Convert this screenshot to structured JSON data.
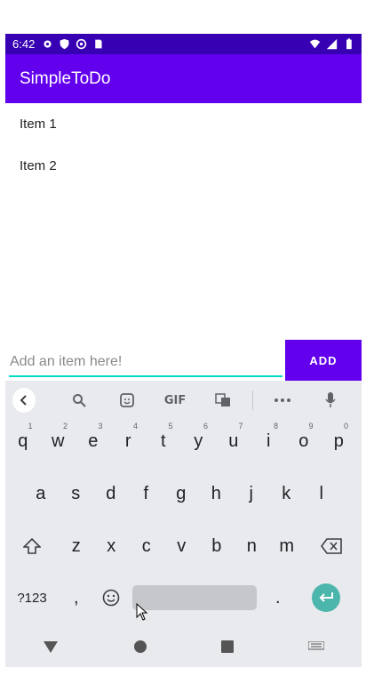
{
  "status_bar": {
    "time": "6:42",
    "icons_left": [
      "gear-icon",
      "shield-icon",
      "at-icon",
      "sd-card-icon"
    ],
    "icons_right": [
      "wifi-icon",
      "signal-icon",
      "battery-icon"
    ]
  },
  "app_bar": {
    "title": "SimpleToDo",
    "color": "#6200ee"
  },
  "list": {
    "items": [
      "Item 1",
      "Item 2"
    ]
  },
  "input": {
    "placeholder": "Add an item here!",
    "value": ""
  },
  "add_button": {
    "label": "ADD"
  },
  "keyboard": {
    "toolbar": {
      "gif_label": "GIF",
      "icons": [
        "chevron-left-icon",
        "search-icon",
        "sticker-icon",
        "gif-icon",
        "translate-icon",
        "more-icon",
        "mic-icon"
      ]
    },
    "row1": [
      {
        "k": "q",
        "h": "1"
      },
      {
        "k": "w",
        "h": "2"
      },
      {
        "k": "e",
        "h": "3"
      },
      {
        "k": "r",
        "h": "4"
      },
      {
        "k": "t",
        "h": "5"
      },
      {
        "k": "y",
        "h": "6"
      },
      {
        "k": "u",
        "h": "7"
      },
      {
        "k": "i",
        "h": "8"
      },
      {
        "k": "o",
        "h": "9"
      },
      {
        "k": "p",
        "h": "0"
      }
    ],
    "row2": [
      "a",
      "s",
      "d",
      "f",
      "g",
      "h",
      "j",
      "k",
      "l"
    ],
    "row3": [
      "z",
      "x",
      "c",
      "v",
      "b",
      "n",
      "m"
    ],
    "row4": {
      "symbols": "?123",
      "comma": ",",
      "period": "."
    }
  },
  "accent_color": "#03dac5"
}
